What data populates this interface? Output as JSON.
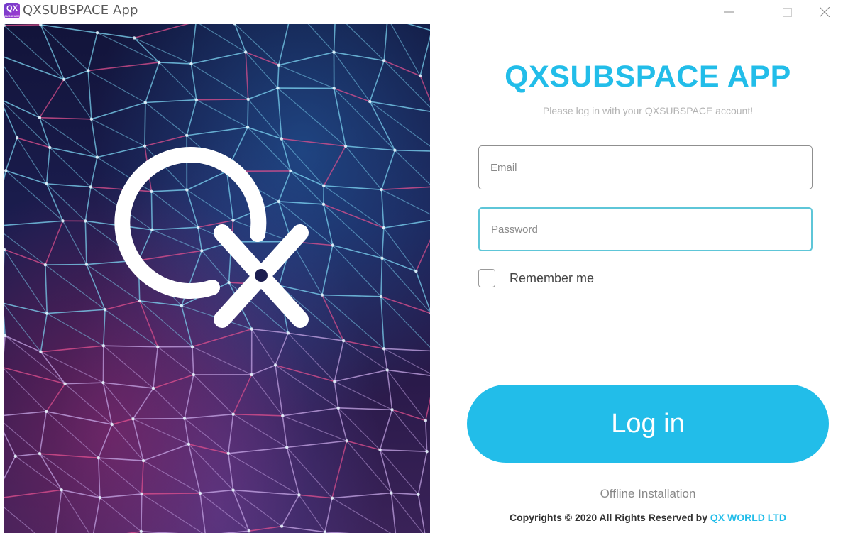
{
  "window": {
    "title": "QXSUBSPACE App",
    "icon_text": "QX",
    "icon_subtext": "SUBSPACE",
    "controls": {
      "minimize": "minimize-icon",
      "maximize": "maximize-icon",
      "close": "close-icon"
    }
  },
  "hero": {
    "logo": "qx-logo-icon",
    "background": "network-mesh-image"
  },
  "login": {
    "heading": "QXSUBSPACE APP",
    "subtitle": "Please log in with your QXSUBSPACE account!",
    "email_placeholder": "Email",
    "email_value": "",
    "password_placeholder": "Password",
    "password_value": "",
    "remember_label": "Remember me",
    "remember_checked": false,
    "login_button": "Log in",
    "offline_link": "Offline Installation"
  },
  "footer": {
    "copyright_text": "Copyrights © 2020 All Rights Reserved by ",
    "company": "QX WORLD LTD"
  },
  "colors": {
    "accent": "#22bde9",
    "subtitle": "#b3b3b3",
    "border": "#8f8f8f",
    "focus_border": "#5ec6d8"
  }
}
